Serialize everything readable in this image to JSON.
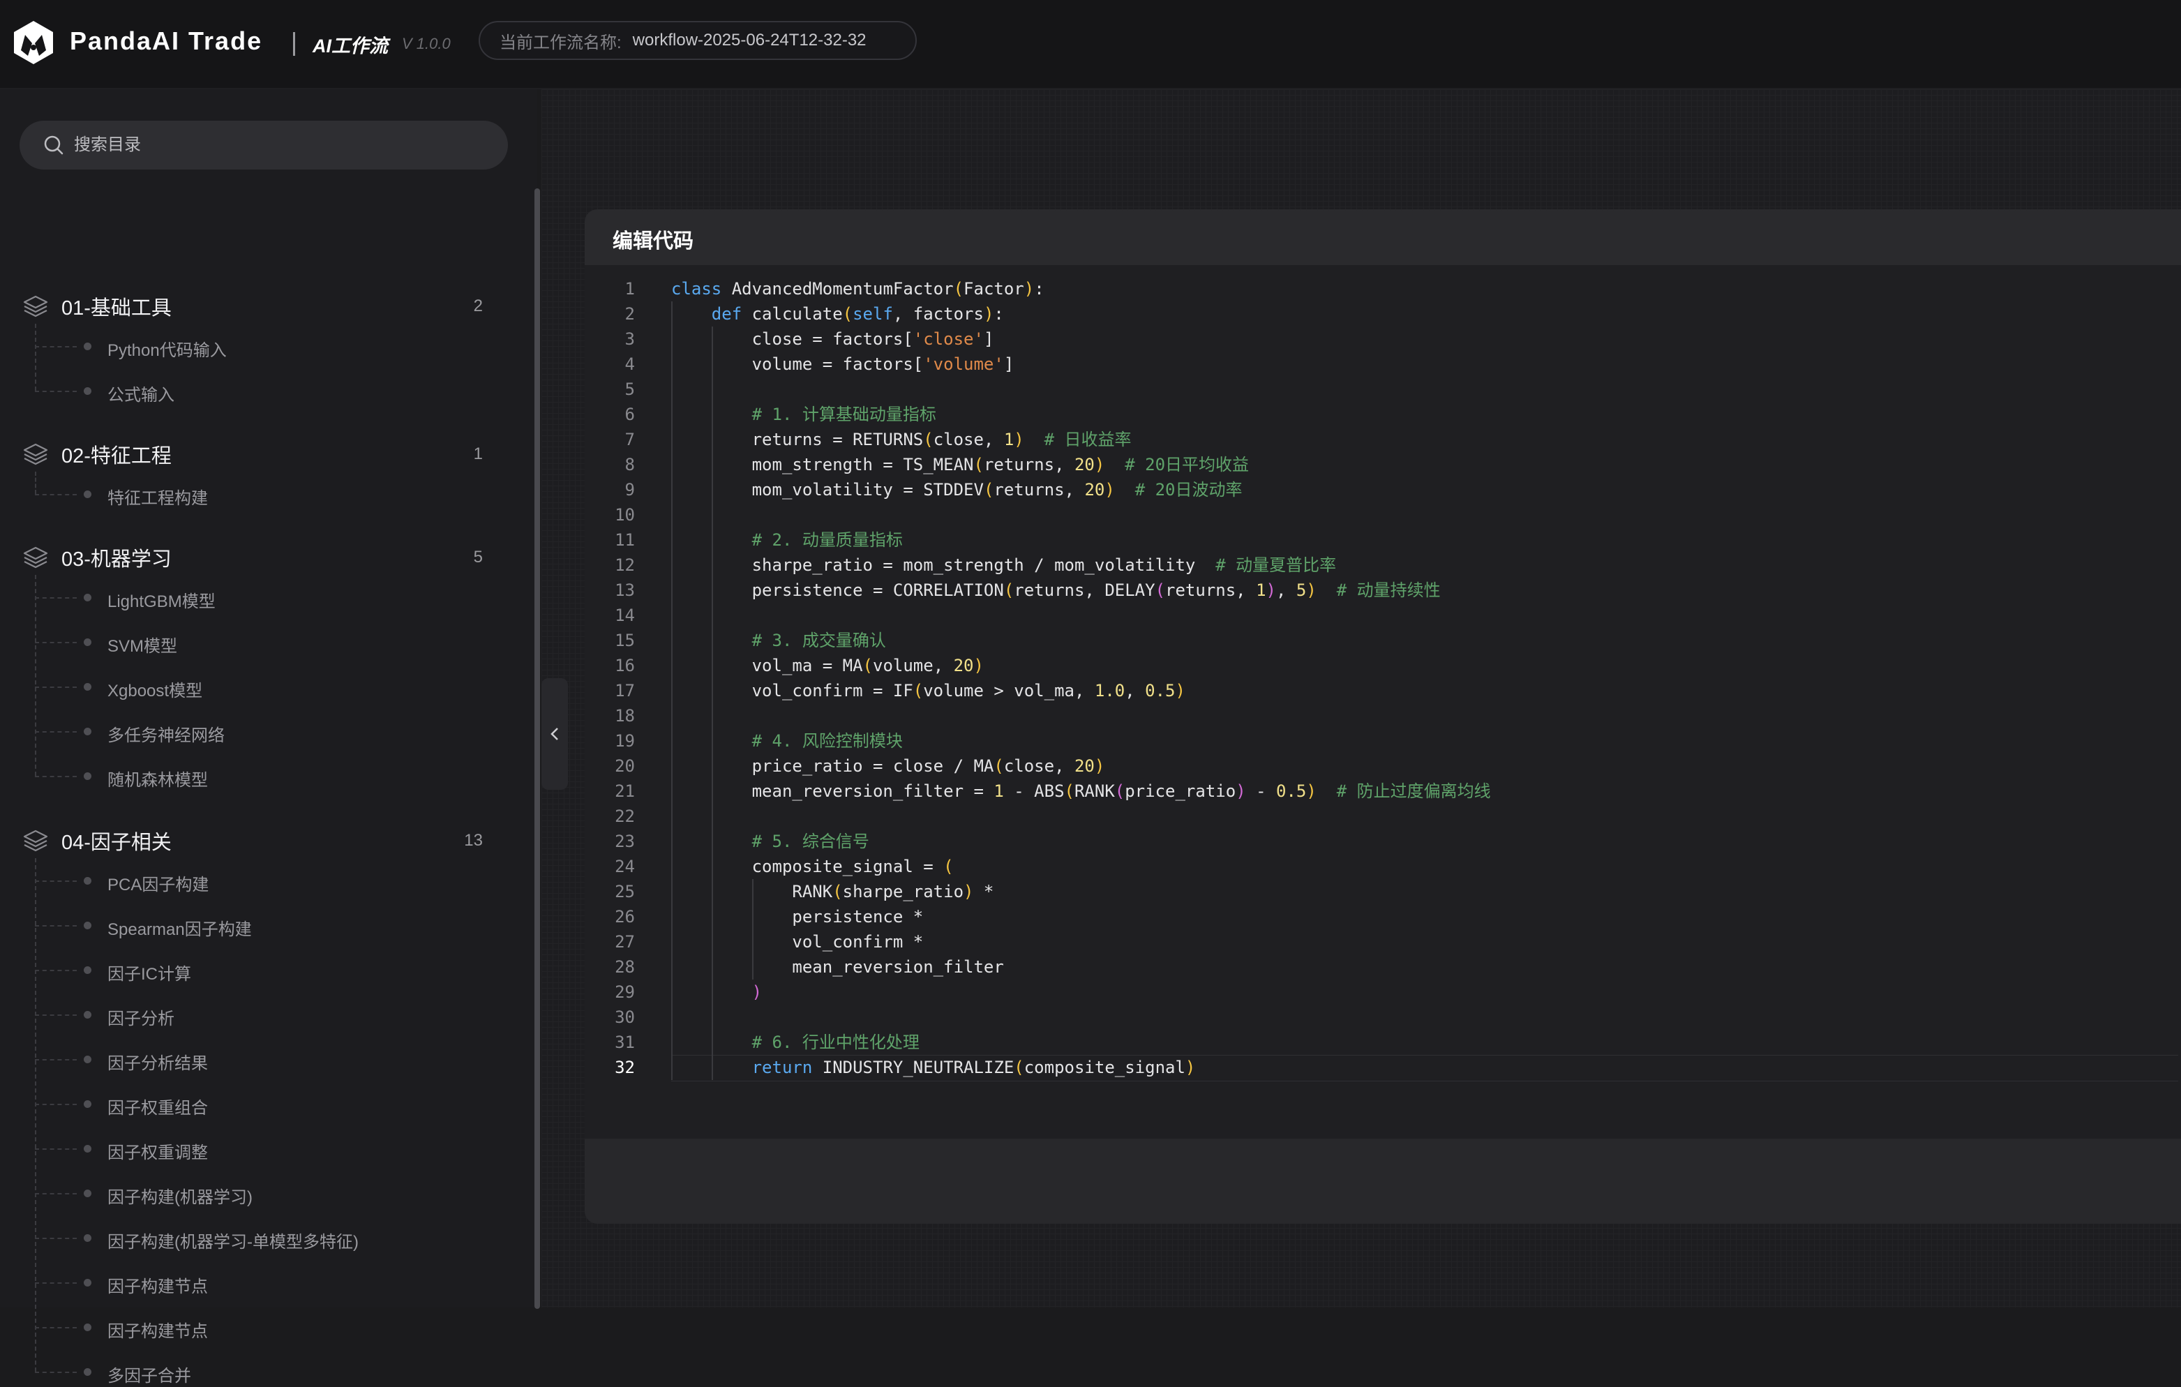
{
  "header": {
    "app_name": "PandaAI Trade",
    "workflow_label": "AI工作流",
    "version": "V 1.0.0",
    "current_workflow_key": "当前工作流名称:",
    "current_workflow_value": "workflow-2025-06-24T12-32-32"
  },
  "sidebar": {
    "search_placeholder": "搜索目录",
    "groups": [
      {
        "title": "01-基础工具",
        "count": "2",
        "items": [
          "Python代码输入",
          "公式输入"
        ]
      },
      {
        "title": "02-特征工程",
        "count": "1",
        "items": [
          "特征工程构建"
        ]
      },
      {
        "title": "03-机器学习",
        "count": "5",
        "items": [
          "LightGBM模型",
          "SVM模型",
          "Xgboost模型",
          "多任务神经网络",
          "随机森林模型"
        ]
      },
      {
        "title": "04-因子相关",
        "count": "13",
        "items": [
          "PCA因子构建",
          "Spearman因子构建",
          "因子IC计算",
          "因子分析",
          "因子分析结果",
          "因子权重组合",
          "因子权重调整",
          "因子构建(机器学习)",
          "因子构建(机器学习-单模型多特征)",
          "因子构建节点",
          "因子构建节点",
          "多因子合并"
        ]
      }
    ]
  },
  "editor": {
    "title": "编辑代码",
    "current_line": 32,
    "lines": [
      "class AdvancedMomentumFactor(Factor):",
      "    def calculate(self, factors):",
      "        close = factors['close']",
      "        volume = factors['volume']",
      "",
      "        # 1. 计算基础动量指标",
      "        returns = RETURNS(close, 1)  # 日收益率",
      "        mom_strength = TS_MEAN(returns, 20)  # 20日平均收益",
      "        mom_volatility = STDDEV(returns, 20)  # 20日波动率",
      "",
      "        # 2. 动量质量指标",
      "        sharpe_ratio = mom_strength / mom_volatility  # 动量夏普比率",
      "        persistence = CORRELATION(returns, DELAY(returns, 1), 5)  # 动量持续性",
      "",
      "        # 3. 成交量确认",
      "        vol_ma = MA(volume, 20)",
      "        vol_confirm = IF(volume > vol_ma, 1.0, 0.5)",
      "",
      "        # 4. 风险控制模块",
      "        price_ratio = close / MA(close, 20)",
      "        mean_reversion_filter = 1 - ABS(RANK(price_ratio) - 0.5)  # 防止过度偏离均线",
      "",
      "        # 5. 综合信号",
      "        composite_signal = (",
      "            RANK(sharpe_ratio) *",
      "            persistence *",
      "            vol_confirm *",
      "            mean_reversion_filter",
      "        )",
      "",
      "        # 6. 行业中性化处理",
      "        return INDUSTRY_NEUTRALIZE(composite_signal)"
    ]
  }
}
